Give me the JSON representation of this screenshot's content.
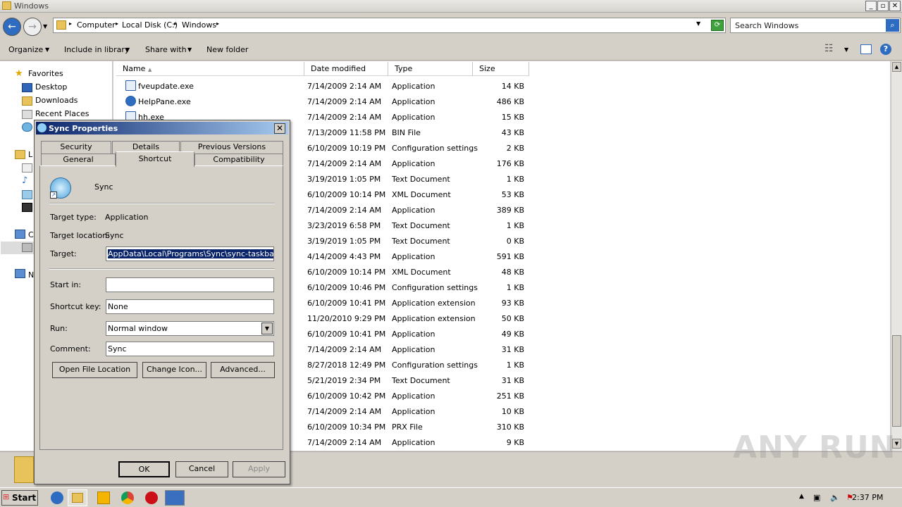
{
  "window": {
    "title": "Windows",
    "min": "_",
    "max": "▫",
    "close": "✕"
  },
  "address": {
    "crumbs": [
      "Computer",
      "Local Disk (C:)",
      "Windows"
    ],
    "search_placeholder": "Search Windows"
  },
  "toolbar": {
    "organize": "Organize",
    "include": "Include in library",
    "share": "Share with",
    "new_folder": "New folder"
  },
  "nav": {
    "favorites": "Favorites",
    "desktop": "Desktop",
    "downloads": "Downloads",
    "recent": "Recent Places",
    "libraries_partial": "L",
    "computer_partial": "C",
    "network_partial": "N"
  },
  "columns": {
    "name": "Name",
    "date": "Date modified",
    "type": "Type",
    "size": "Size"
  },
  "rows": [
    {
      "name": "fveupdate.exe",
      "date": "7/14/2009 2:14 AM",
      "type": "Application",
      "size": "14 KB"
    },
    {
      "name": "HelpPane.exe",
      "date": "7/14/2009 2:14 AM",
      "type": "Application",
      "size": "486 KB"
    },
    {
      "name": "hh.exe",
      "date": "7/14/2009 2:14 AM",
      "type": "Application",
      "size": "15 KB"
    },
    {
      "name": "",
      "date": "7/13/2009 11:58 PM",
      "type": "BIN File",
      "size": "43 KB"
    },
    {
      "name": "",
      "date": "6/10/2009 10:19 PM",
      "type": "Configuration settings",
      "size": "2 KB"
    },
    {
      "name": "",
      "date": "7/14/2009 2:14 AM",
      "type": "Application",
      "size": "176 KB"
    },
    {
      "name": "",
      "date": "3/19/2019 1:05 PM",
      "type": "Text Document",
      "size": "1 KB"
    },
    {
      "name": "",
      "date": "6/10/2009 10:14 PM",
      "type": "XML Document",
      "size": "53 KB"
    },
    {
      "name": "",
      "date": "7/14/2009 2:14 AM",
      "type": "Application",
      "size": "389 KB"
    },
    {
      "name": "",
      "date": "3/23/2019 6:58 PM",
      "type": "Text Document",
      "size": "1 KB"
    },
    {
      "name": "",
      "date": "3/19/2019 1:05 PM",
      "type": "Text Document",
      "size": "0 KB"
    },
    {
      "name": "",
      "date": "4/14/2009 4:43 PM",
      "type": "Application",
      "size": "591 KB"
    },
    {
      "name": "",
      "date": "6/10/2009 10:14 PM",
      "type": "XML Document",
      "size": "48 KB"
    },
    {
      "name": "",
      "date": "6/10/2009 10:46 PM",
      "type": "Configuration settings",
      "size": "1 KB"
    },
    {
      "name": "",
      "date": "6/10/2009 10:41 PM",
      "type": "Application extension",
      "size": "93 KB"
    },
    {
      "name": "",
      "date": "11/20/2010 9:29 PM",
      "type": "Application extension",
      "size": "50 KB"
    },
    {
      "name": "",
      "date": "6/10/2009 10:41 PM",
      "type": "Application",
      "size": "49 KB"
    },
    {
      "name": "",
      "date": "7/14/2009 2:14 AM",
      "type": "Application",
      "size": "31 KB"
    },
    {
      "name": "",
      "date": "8/27/2018 12:49 PM",
      "type": "Configuration settings",
      "size": "1 KB"
    },
    {
      "name": "",
      "date": "5/21/2019 2:34 PM",
      "type": "Text Document",
      "size": "31 KB"
    },
    {
      "name": "",
      "date": "6/10/2009 10:42 PM",
      "type": "Application",
      "size": "251 KB"
    },
    {
      "name": "",
      "date": "7/14/2009 2:14 AM",
      "type": "Application",
      "size": "10 KB"
    },
    {
      "name": "",
      "date": "6/10/2009 10:34 PM",
      "type": "PRX File",
      "size": "310 KB"
    },
    {
      "name": "",
      "date": "7/14/2009 2:14 AM",
      "type": "Application",
      "size": "9 KB"
    }
  ],
  "dialog": {
    "title": "Sync Properties",
    "close": "✕",
    "tabs_back": [
      "Security",
      "Details",
      "Previous Versions"
    ],
    "tabs_front": [
      "General",
      "Shortcut",
      "Compatibility"
    ],
    "app_name": "Sync",
    "target_type_label": "Target type:",
    "target_type": "Application",
    "target_location_label": "Target location:",
    "target_location": "Sync",
    "target_label": "Target:",
    "target": "AppData\\Local\\Programs\\Sync\\sync-taskbar.exe",
    "start_in_label": "Start in:",
    "start_in": "",
    "shortcut_key_label": "Shortcut key:",
    "shortcut_key": "None",
    "run_label": "Run:",
    "run": "Normal window",
    "comment_label": "Comment:",
    "comment": "Sync",
    "open_location": "Open File Location",
    "change_icon": "Change Icon...",
    "advanced": "Advanced...",
    "ok": "OK",
    "cancel": "Cancel",
    "apply": "Apply"
  },
  "taskbar": {
    "start": "Start",
    "clock": "2:37 PM"
  },
  "watermark": "ANY RUN",
  "colors": {
    "selection": "#0a246a",
    "titlebar": "#0a246a",
    "accent": "#1c5fb8"
  }
}
